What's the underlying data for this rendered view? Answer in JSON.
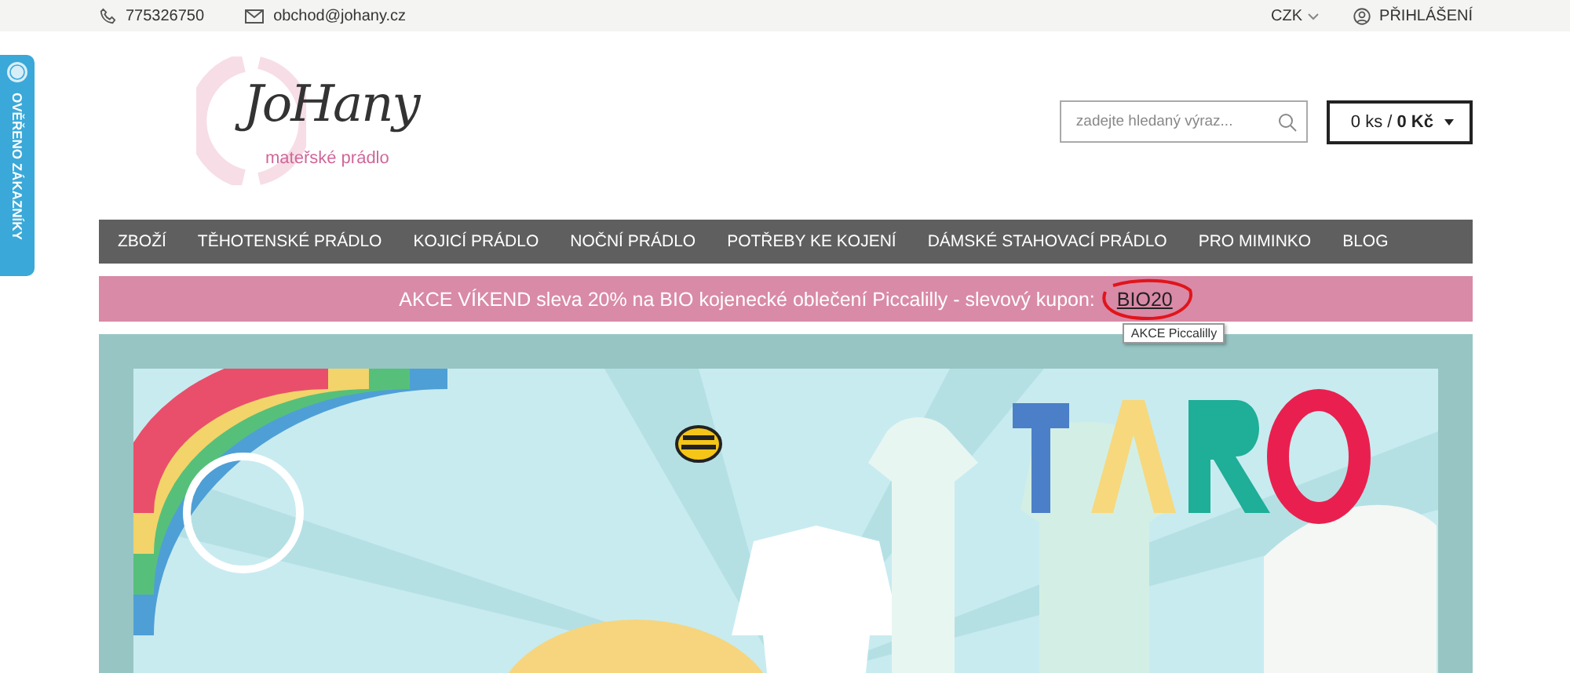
{
  "top_bar": {
    "phone": "775326750",
    "email": "obchod@johany.cz",
    "currency": "CZK",
    "login": "PŘIHLÁŠENÍ"
  },
  "side_badge": {
    "label": "OVĚŘENO ZÁKAZNÍKY"
  },
  "logo": {
    "name": "JoHany",
    "tagline": "mateřské prádlo"
  },
  "search": {
    "placeholder": "zadejte hledaný výraz..."
  },
  "cart": {
    "label": "0 ks / **0 Kč**"
  },
  "nav": [
    "ZBOŽÍ",
    "TĚHOTENSKÉ PRÁDLO",
    "KOJICÍ PRÁDLO",
    "NOČNÍ PRÁDLO",
    "POTŘEBY KE KOJENÍ",
    "DÁMSKÉ STAHOVACÍ PRÁDLO",
    "PRO MIMINKO",
    "BLOG"
  ],
  "promo": {
    "text": "AKCE VÍKEND sleva 20% na BIO kojenecké oblečení Piccalilly - slevový kupon:",
    "code": "BIO20",
    "tooltip": "AKCE Piccalilly"
  }
}
